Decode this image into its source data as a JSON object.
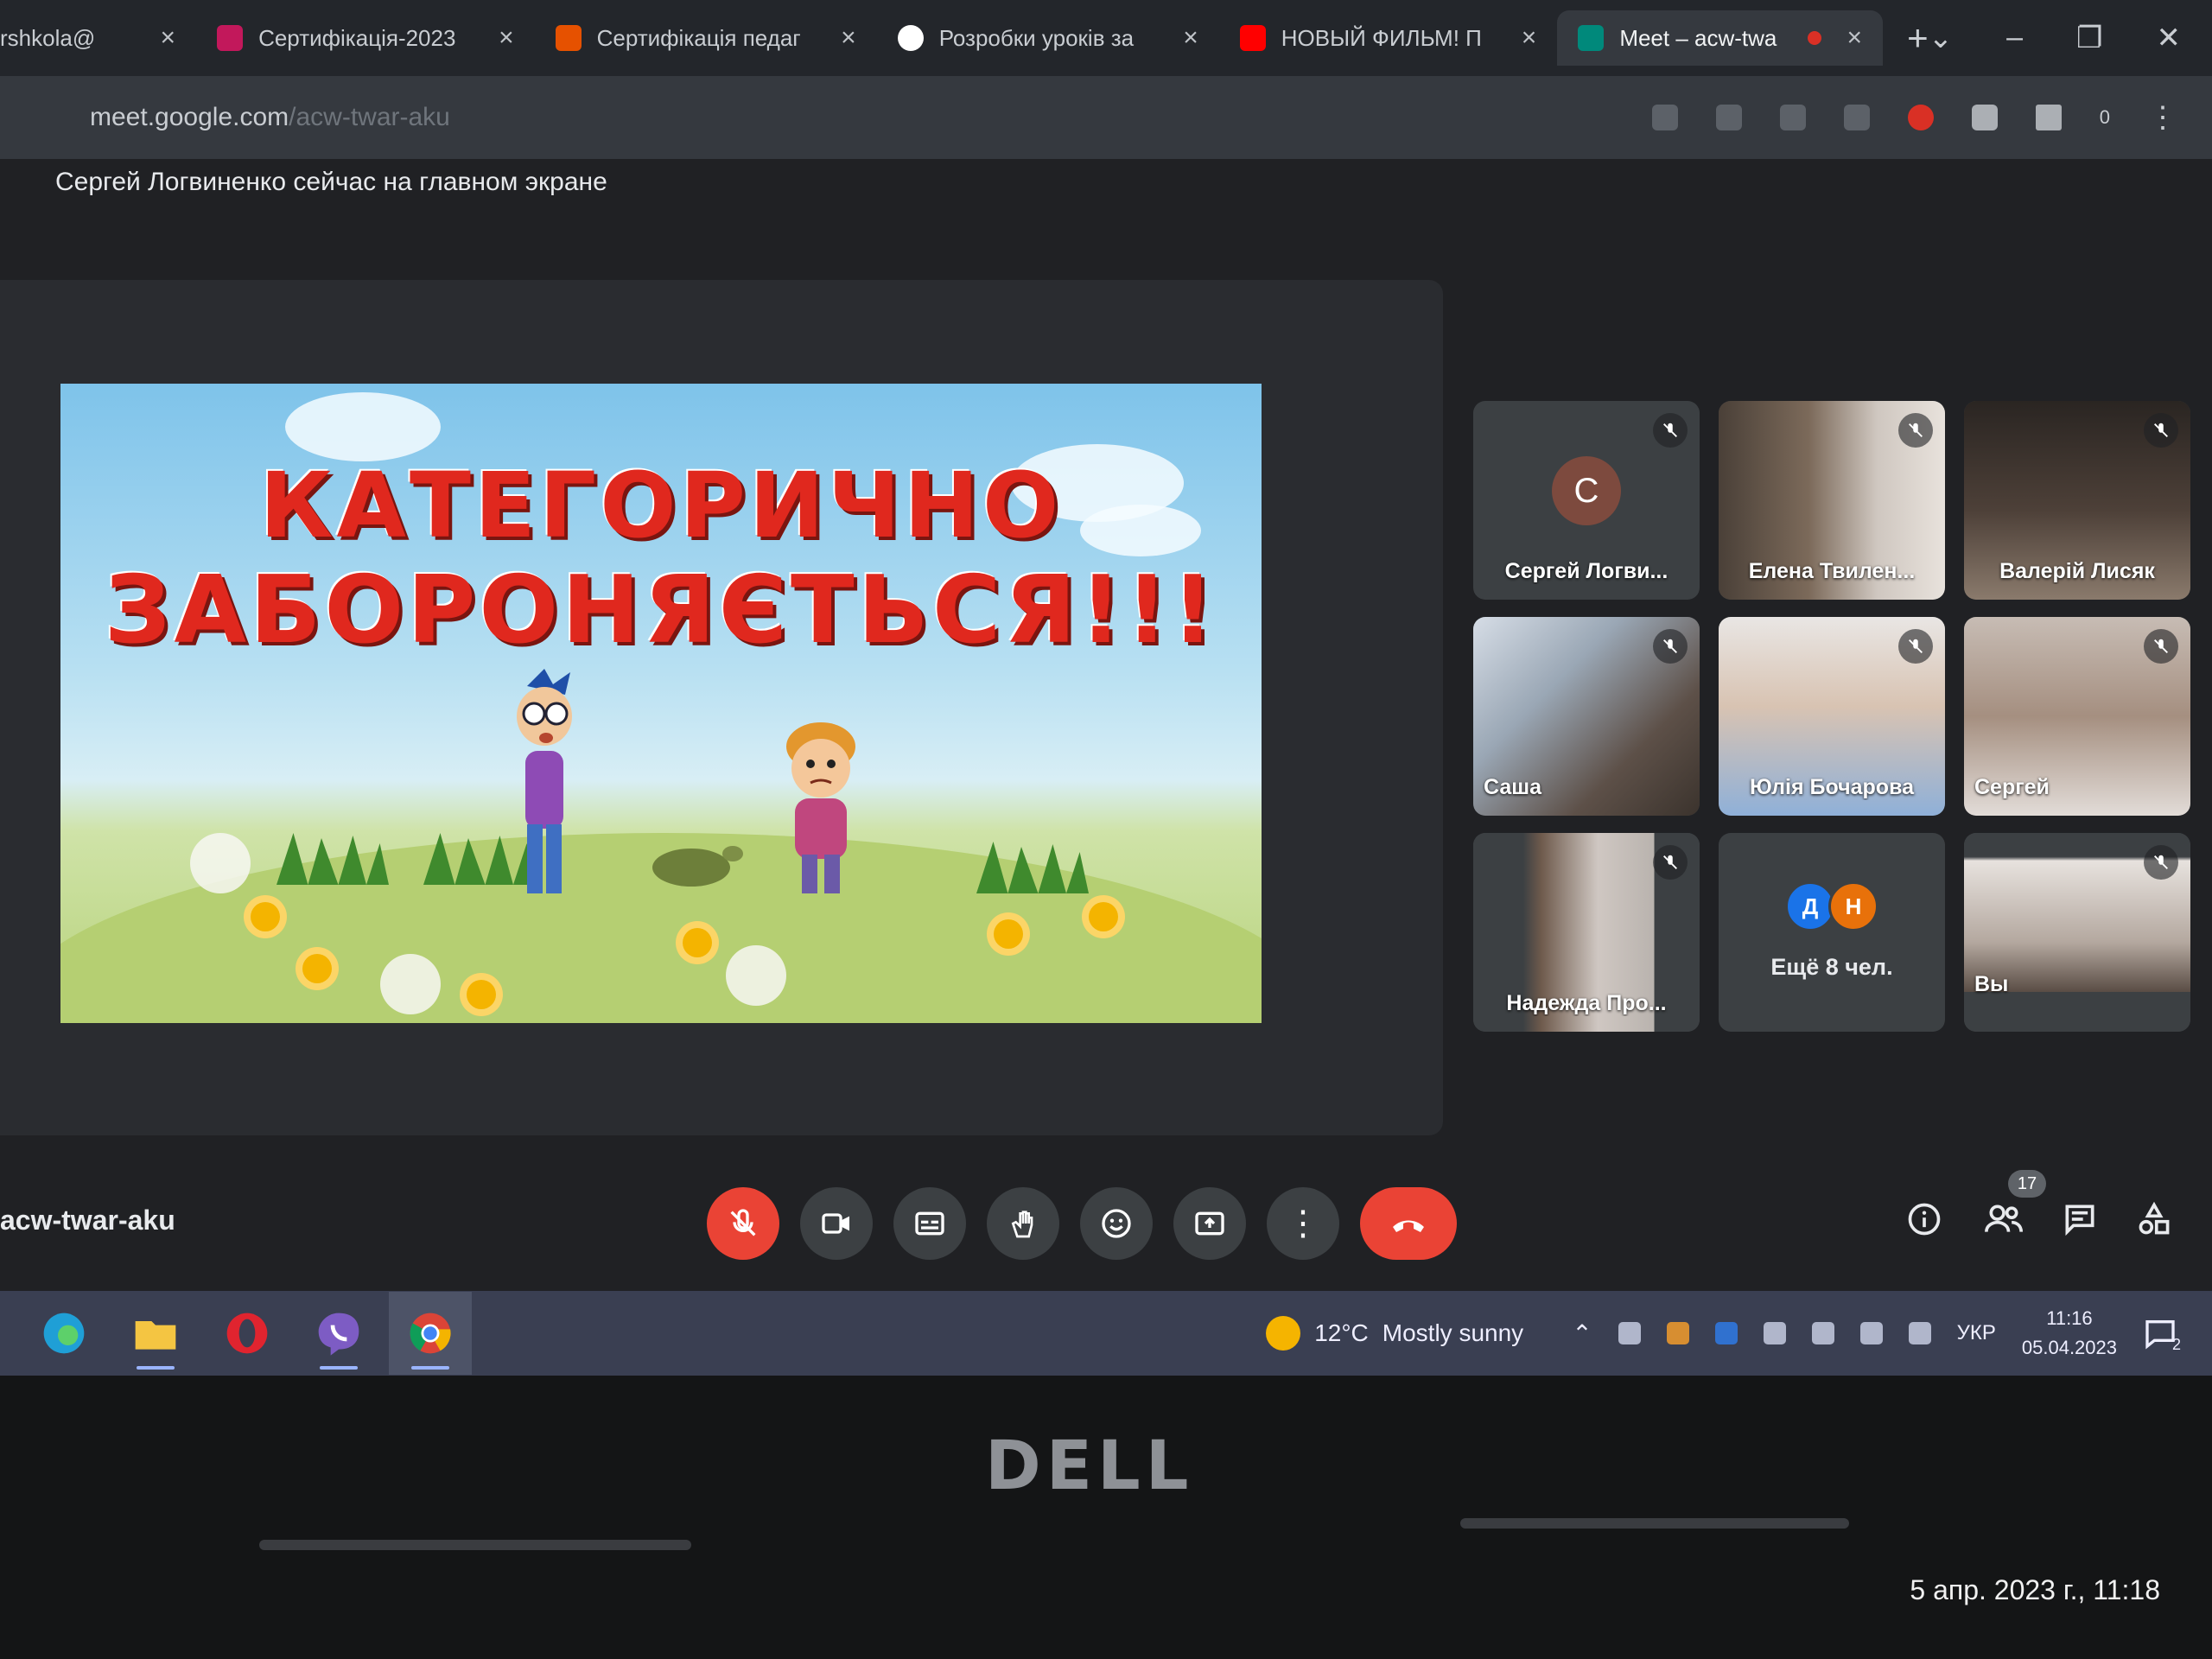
{
  "browser": {
    "tabs": [
      {
        "title": "rshkola@",
        "color": "#5f6368",
        "active": false
      },
      {
        "title": "Сертифікація-2023",
        "color": "#c2185b",
        "active": false
      },
      {
        "title": "Сертифікація педаг",
        "color": "#e65100",
        "active": false
      },
      {
        "title": "Розробки уроків за",
        "color": "#ffffff",
        "active": false
      },
      {
        "title": "НОВЫЙ ФИЛЬМ! П",
        "color": "#ff0000",
        "active": false
      },
      {
        "title": "Meet – acw-twa",
        "color": "#00897b",
        "active": true
      }
    ],
    "url_host": "meet.google.com",
    "url_path": "/acw-twar-aku",
    "extension_badge": "0"
  },
  "meet": {
    "presenter_banner": "Сергей Логвиненко сейчас на главном экране",
    "meeting_code": "acw-twar-aku",
    "people_count": "17",
    "slide": {
      "line1": "КАТЕГОРИЧНО",
      "line2": "ЗАБОРОНЯЄТЬСЯ!!!"
    },
    "participants": [
      {
        "name": "Сергей Логви...",
        "avatar_letter": "С",
        "has_video": false,
        "muted": true
      },
      {
        "name": "Елена Твилен...",
        "has_video": true,
        "muted": true
      },
      {
        "name": "Валерій Лисяк",
        "has_video": true,
        "muted": true
      },
      {
        "name": "Саша",
        "has_video": true,
        "muted": true
      },
      {
        "name": "Юлія Бочарова",
        "has_video": true,
        "muted": true
      },
      {
        "name": "Сергей",
        "has_video": true,
        "muted": true
      },
      {
        "name": "Надежда Про...",
        "has_video": true,
        "muted": true
      },
      {
        "name": "Вы",
        "has_video": true,
        "muted": true
      }
    ],
    "more_tile": {
      "label": "Ещё 8 чел.",
      "avatars": [
        {
          "letter": "Д",
          "color": "#1a73e8"
        },
        {
          "letter": "Н",
          "color": "#e8710a"
        }
      ]
    },
    "controls": [
      "mic-off",
      "camera",
      "captions",
      "raise-hand",
      "emoji",
      "present",
      "more",
      "end-call"
    ],
    "side_controls": [
      "info",
      "people",
      "chat",
      "activities"
    ]
  },
  "taskbar": {
    "weather_temp": "12°C",
    "weather_text": "Mostly sunny",
    "language": "УКР",
    "time": "11:16",
    "date": "05.04.2023",
    "notifications": "2",
    "apps": [
      "edge",
      "file-explorer",
      "opera",
      "viber",
      "chrome"
    ]
  },
  "device": {
    "brand": "DELL",
    "photo_timestamp": "5 апр. 2023 г., 11:18"
  },
  "colors": {
    "meet_bg": "#202124",
    "tile_bg": "#3c4043",
    "end_call": "#ea4335",
    "slide_text": "#e0281e"
  }
}
